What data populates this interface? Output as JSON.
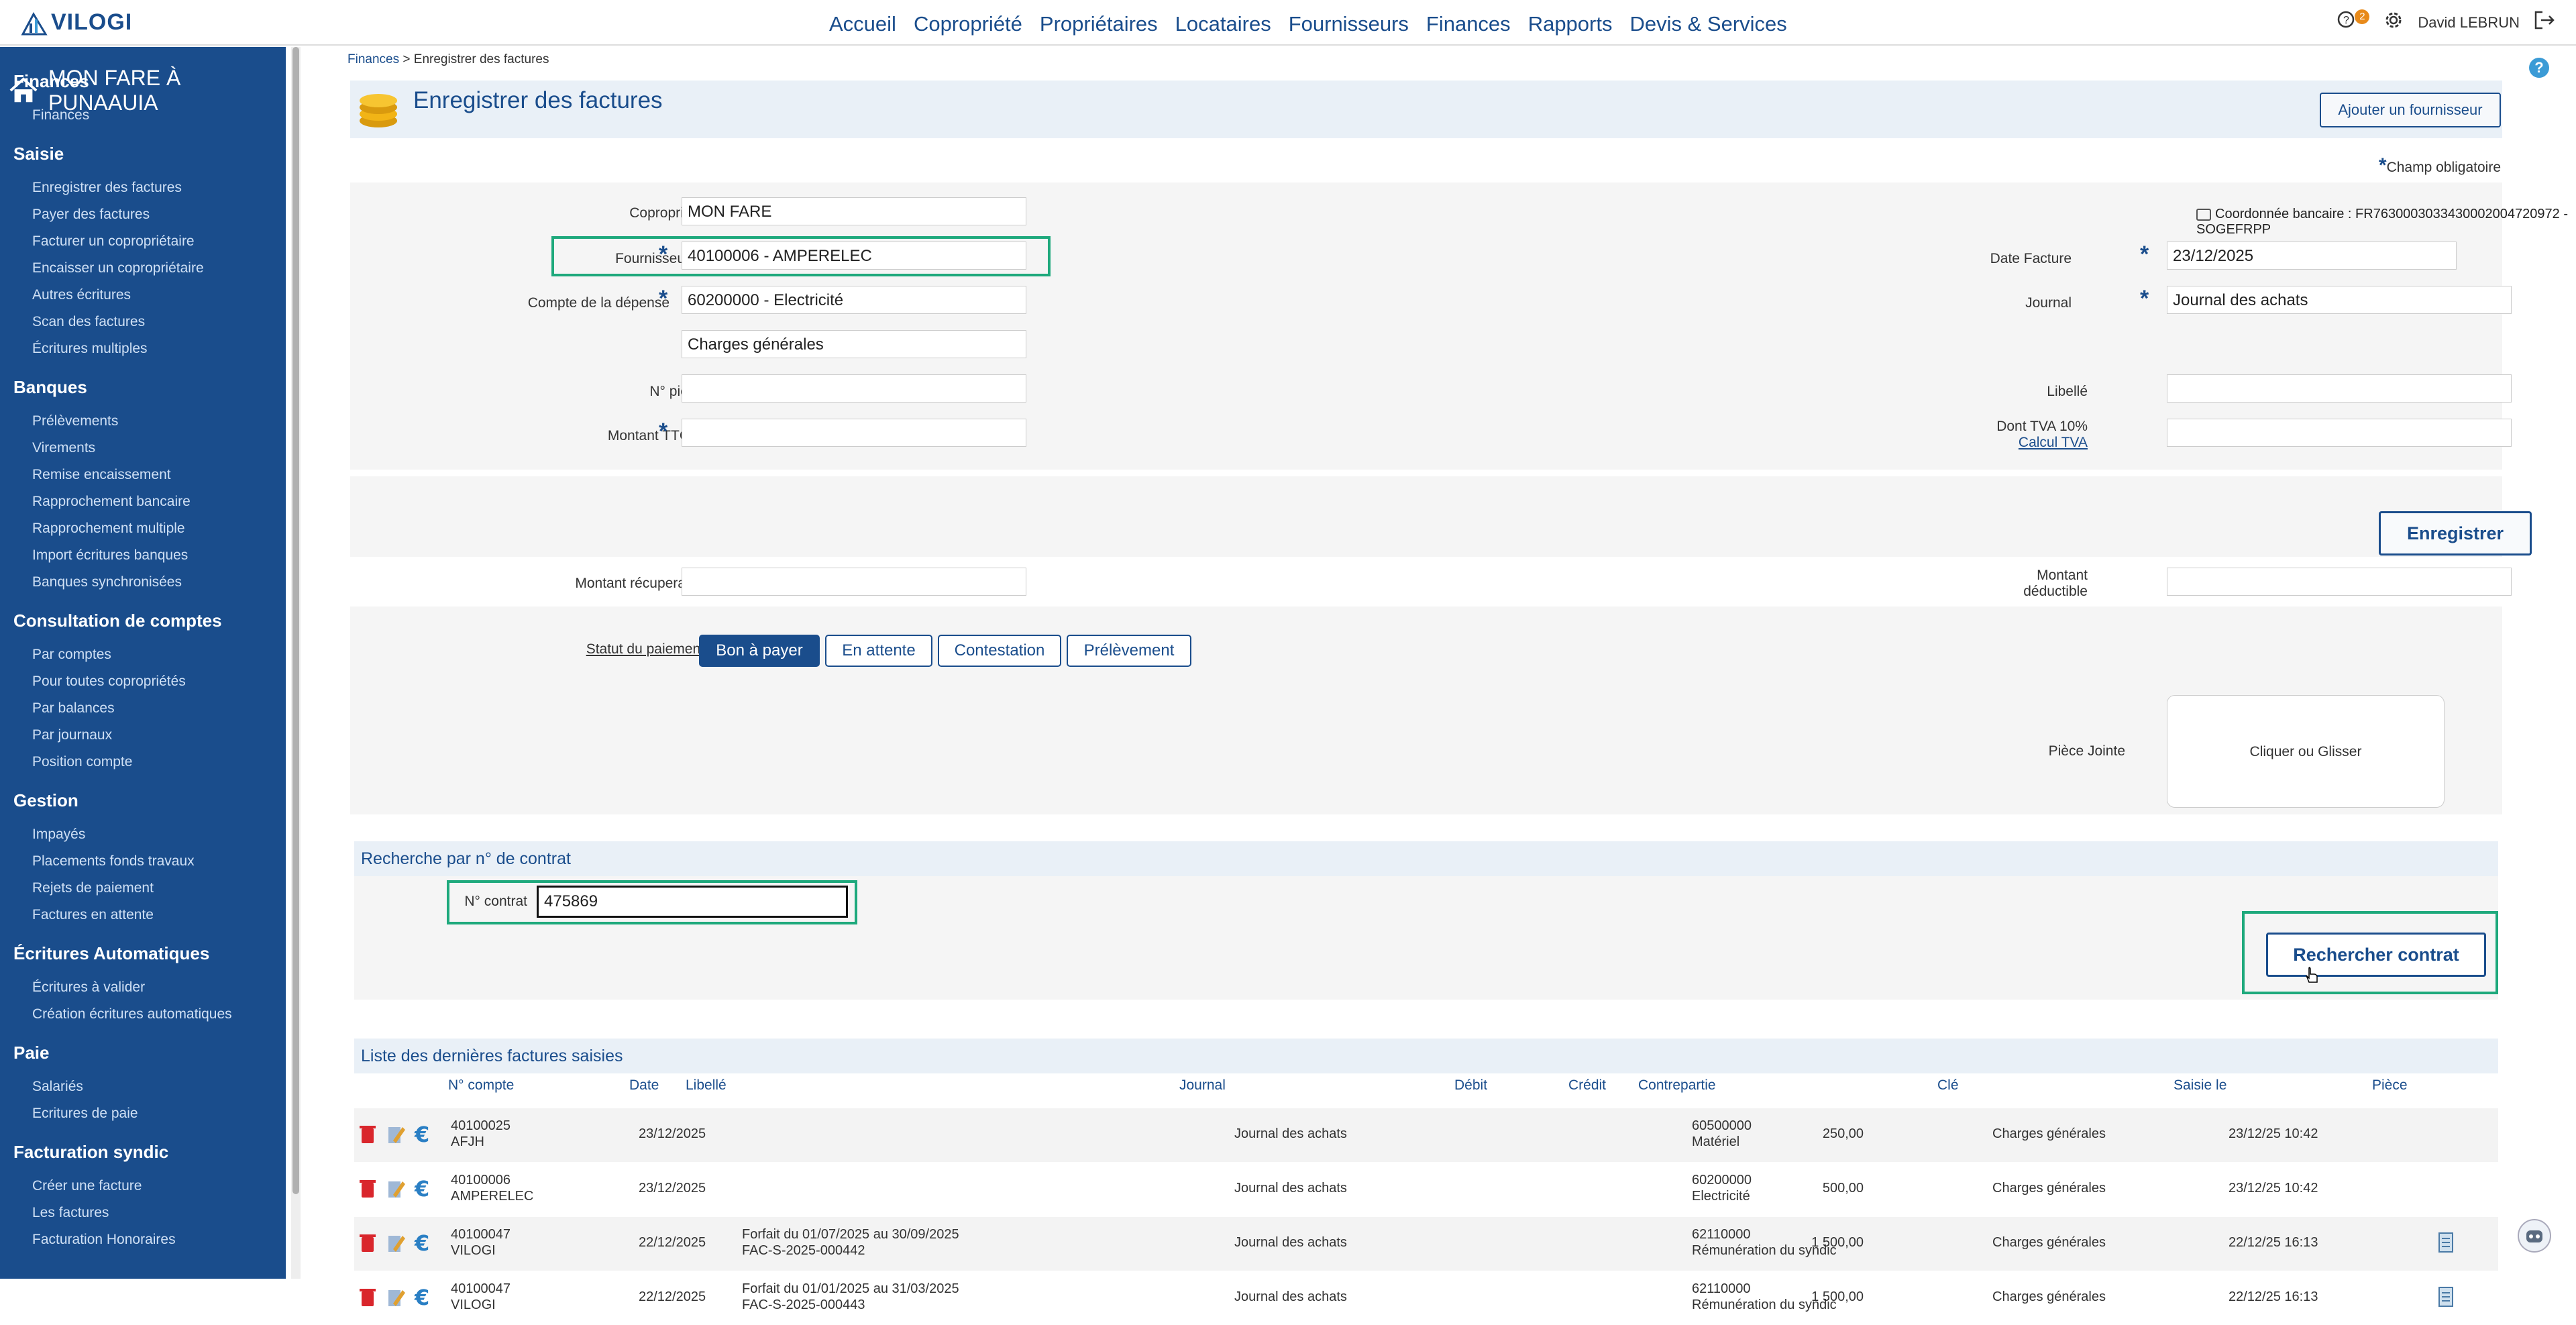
{
  "app": {
    "logo": "VILOGI",
    "user": "David LEBRUN",
    "notif_count": "2"
  },
  "topnav": [
    "Accueil",
    "Copropriété",
    "Propriétaires",
    "Locataires",
    "Fournisseurs",
    "Finances",
    "Rapports",
    "Devis & Services"
  ],
  "sidebar": {
    "title": "MON FARE À PUNAAUIA",
    "sections": [
      {
        "label": "Finances",
        "items": [
          "Finances"
        ]
      },
      {
        "label": "Saisie",
        "items": [
          "Enregistrer des factures",
          "Payer des factures",
          "Facturer un copropriétaire",
          "Encaisser un copropriétaire",
          "Autres écritures",
          "Scan des factures",
          "Écritures multiples"
        ]
      },
      {
        "label": "Banques",
        "items": [
          "Prélèvements",
          "Virements",
          "Remise encaissement",
          "Rapprochement bancaire",
          "Rapprochement multiple",
          "Import écritures banques",
          "Banques synchronisées"
        ]
      },
      {
        "label": "Consultation de comptes",
        "items": [
          "Par comptes",
          "Pour toutes copropriétés",
          "Par balances",
          "Par journaux",
          "Position compte"
        ]
      },
      {
        "label": "Gestion",
        "items": [
          "Impayés",
          "Placements fonds travaux",
          "Rejets de paiement",
          "Factures en attente"
        ]
      },
      {
        "label": "Écritures Automatiques",
        "items": [
          "Écritures à valider",
          "Création écritures automatiques"
        ]
      },
      {
        "label": "Paie",
        "items": [
          "Salariés",
          "Ecritures de paie"
        ]
      },
      {
        "label": "Facturation syndic",
        "items": [
          "Créer une facture",
          "Les factures",
          "Facturation Honoraires"
        ]
      }
    ]
  },
  "breadcrumb": {
    "root": "Finances",
    "current": "Enregistrer des factures"
  },
  "page": {
    "title": "Enregistrer des factures",
    "add_supplier": "Ajouter un fournisseur",
    "required_note": "Champ obligatoire",
    "bank_info": "Coordonnée bancaire : FR7630003033430002004720972 - SOGEFRPP"
  },
  "form": {
    "copro_label": "Copropriété",
    "copro_value": "MON FARE",
    "fournisseur_label": "Fournisseur",
    "fournisseur_value": "40100006 - AMPERELEC",
    "compte_label": "Compte de la dépense",
    "compte_value": "60200000 - Electricité",
    "cle_label": "Clé",
    "cle_value": "Charges générales",
    "piece_label": "N° pièce",
    "piece_value": "",
    "ttc_label": "Montant TTC",
    "ttc_value": "",
    "date_label": "Date Facture",
    "date_value": "23/12/2025",
    "journal_label": "Journal",
    "journal_value": "Journal des achats",
    "libelle_label": "Libellé",
    "libelle_value": "",
    "tva_label": "Dont TVA 10%",
    "tva_link": "Calcul TVA",
    "tva_value": "",
    "save": "Enregistrer",
    "recup_label": "Montant récuperable",
    "recup_value": "",
    "deduct_label1": "Montant",
    "deduct_label2": "déductible",
    "deduct_value": "",
    "statut_label": "Statut du paiement",
    "statuts": [
      "Bon à payer",
      "En attente",
      "Contestation",
      "Prélèvement"
    ],
    "piece_jointe_label": "Pièce Jointe",
    "dropzone": "Cliquer ou Glisser"
  },
  "contract": {
    "title": "Recherche par n° de contrat",
    "label": "N° contrat",
    "value": "475869",
    "button": "Rechercher contrat"
  },
  "list": {
    "title": "Liste des dernières factures saisies",
    "headers": [
      "N° compte",
      "Date",
      "Libellé",
      "Journal",
      "Débit",
      "Crédit",
      "Contrepartie",
      "Clé",
      "Saisie le",
      "Pièce"
    ],
    "rows": [
      {
        "compte": "40100025",
        "nom": "AFJH",
        "date": "23/12/2025",
        "lib1": "",
        "lib2": "",
        "journal": "Journal des achats",
        "debit": "",
        "credit": "250,00",
        "cp1": "60500000",
        "cp2": "Matériel",
        "cle": "Charges générales",
        "saisie": "23/12/25 10:42",
        "piece": false
      },
      {
        "compte": "40100006",
        "nom": "AMPERELEC",
        "date": "23/12/2025",
        "lib1": "",
        "lib2": "",
        "journal": "Journal des achats",
        "debit": "",
        "credit": "500,00",
        "cp1": "60200000",
        "cp2": "Electricité",
        "cle": "Charges générales",
        "saisie": "23/12/25 10:42",
        "piece": false
      },
      {
        "compte": "40100047",
        "nom": "VILOGI",
        "date": "22/12/2025",
        "lib1": "Forfait du 01/07/2025 au 30/09/2025",
        "lib2": "FAC-S-2025-000442",
        "journal": "Journal des achats",
        "debit": "",
        "credit": "1 500,00",
        "cp1": "62110000",
        "cp2": "Rémunération du syndic",
        "cle": "Charges générales",
        "saisie": "22/12/25 16:13",
        "piece": true
      },
      {
        "compte": "40100047",
        "nom": "VILOGI",
        "date": "22/12/2025",
        "lib1": "Forfait du 01/01/2025 au 31/03/2025",
        "lib2": "FAC-S-2025-000443",
        "journal": "Journal des achats",
        "debit": "",
        "credit": "1 500,00",
        "cp1": "62110000",
        "cp2": "Rémunération du syndic",
        "cle": "Charges générales",
        "saisie": "22/12/25 16:13",
        "piece": true
      }
    ]
  }
}
